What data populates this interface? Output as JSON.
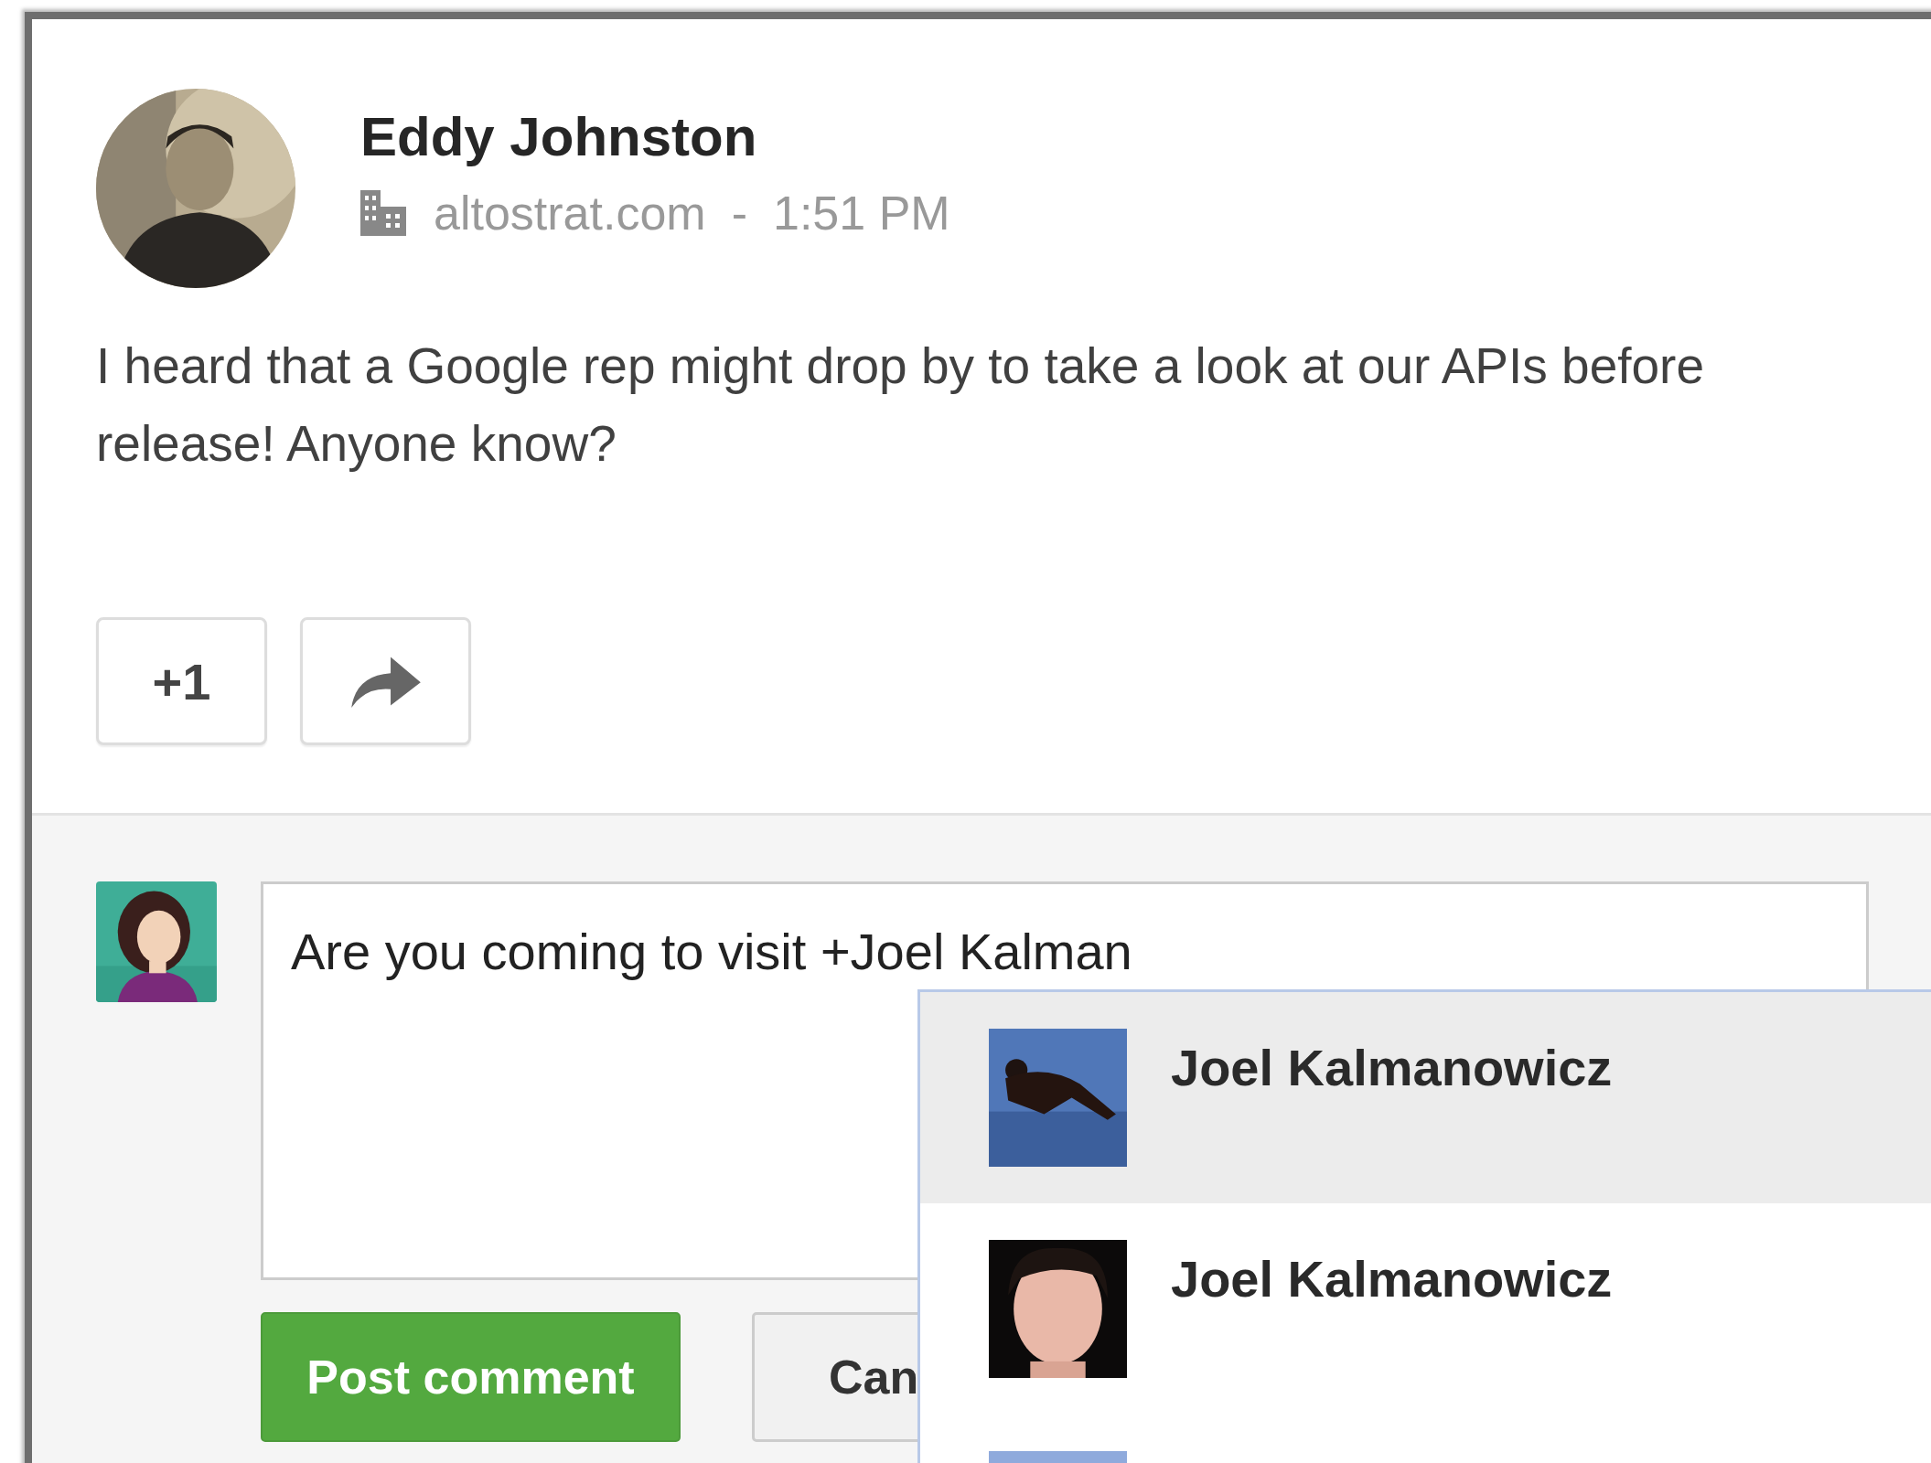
{
  "post": {
    "author": "Eddy Johnston",
    "domain": "altostrat.com",
    "separator": "-",
    "time": "1:51 PM",
    "text": "I heard that a Google rep might drop by to take a look at our APIs before release! Anyone know?",
    "plus_one": "+1"
  },
  "comment": {
    "value": "Are you coming to visit +Joel Kalman",
    "post_button": "Post comment",
    "cancel_button": "Can"
  },
  "suggestions": [
    {
      "name": "Joel Kalmanowicz",
      "selected": true
    },
    {
      "name": "Joel Kalmanowicz",
      "selected": false
    },
    {
      "selected": false
    }
  ]
}
